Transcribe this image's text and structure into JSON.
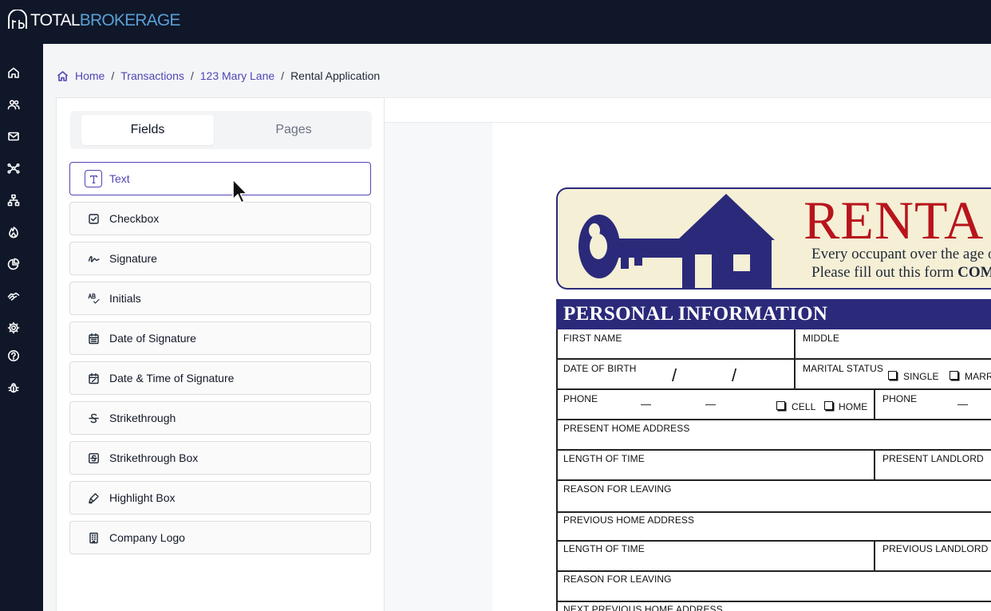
{
  "brand": {
    "total": "TOTAL",
    "brokerage": "BROKERAGE"
  },
  "sidebar": {
    "icons": [
      "home-icon",
      "users-icon",
      "mail-icon",
      "network-icon",
      "sitemap-icon",
      "fire-icon",
      "pie-chart-icon",
      "handshake-icon",
      "settings-icon",
      "help-icon",
      "bug-icon"
    ]
  },
  "breadcrumb": {
    "home": "Home",
    "transactions": "Transactions",
    "property": "123 Mary Lane",
    "current": "Rental Application",
    "separator": "/"
  },
  "tabs": {
    "fields": "Fields",
    "pages": "Pages"
  },
  "fields": [
    {
      "label": "Text",
      "icon": "text-icon"
    },
    {
      "label": "Checkbox",
      "icon": "checkbox-icon"
    },
    {
      "label": "Signature",
      "icon": "signature-icon"
    },
    {
      "label": "Initials",
      "icon": "initials-icon"
    },
    {
      "label": "Date of Signature",
      "icon": "calendar-icon"
    },
    {
      "label": "Date & Time of Signature",
      "icon": "calendar-clock-icon"
    },
    {
      "label": "Strikethrough",
      "icon": "strikethrough-icon"
    },
    {
      "label": "Strikethrough Box",
      "icon": "strikethrough-box-icon"
    },
    {
      "label": "Highlight Box",
      "icon": "highlighter-icon"
    },
    {
      "label": "Company Logo",
      "icon": "building-icon"
    }
  ],
  "document": {
    "title": "RENTA",
    "occupant_line1": "Every occupant over the age o",
    "occupant_line2_prefix": "Please fill out this form ",
    "occupant_line2_bold": "COM",
    "section": "PERSONAL INFORMATION",
    "labels": {
      "first_name": "FIRST NAME",
      "middle": "MIDDLE",
      "dob": "DATE OF BIRTH",
      "marital": "MARITAL STATUS",
      "single": "SINGLE",
      "married": "MARR",
      "phone": "PHONE",
      "cell": "CELL",
      "home": "HOME",
      "phone2": "PHONE",
      "present_address": "PRESENT HOME ADDRESS",
      "length1": "LENGTH OF TIME",
      "present_landlord": "PRESENT LANDLORD",
      "reason1": "REASON FOR LEAVING",
      "previous_address": "PREVIOUS HOME ADDRESS",
      "length2": "LENGTH OF TIME",
      "previous_landlord": "PREVIOUS LANDLORD",
      "reason2": "REASON FOR LEAVING",
      "next_previous": "NEXT PREVIOUS HOME ADDRESS"
    },
    "date_slash": "/",
    "phone_dash": "—"
  },
  "colors": {
    "nav_bg": "#0f1729",
    "accent": "#4f46b5",
    "brand_blue": "#5a9fd4",
    "form_navy": "#2b2a7a",
    "rental_red": "#b8141c"
  }
}
